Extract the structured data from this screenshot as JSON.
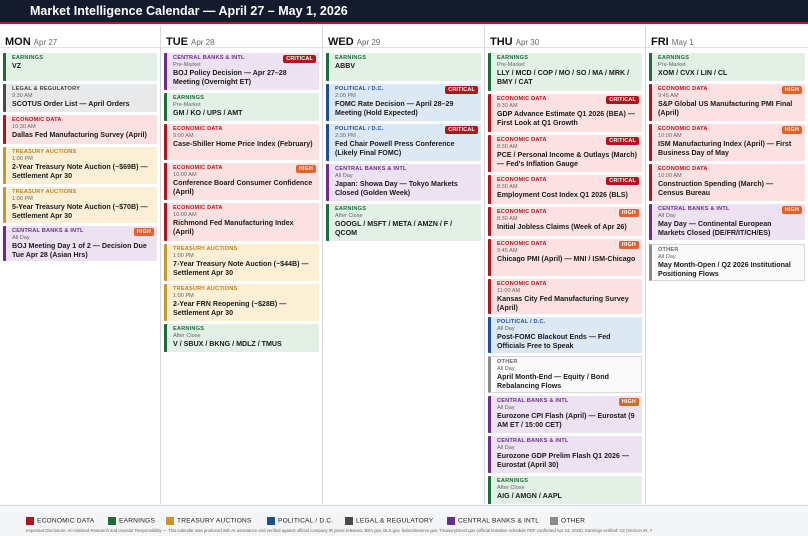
{
  "header": {
    "title": "Market Intelligence Calendar — April 27 – May 1, 2026"
  },
  "colors": {
    "economic_data": "#b3141c",
    "earnings": "#1e6b3a",
    "treasury_auctions": "#c9962a",
    "political_dc": "#1d4f96",
    "legal_regulatory": "#4a4a4a",
    "central_banks_intl": "#6b2c8c",
    "other": "#8a8a8a",
    "badge_critical": "#b3141c",
    "badge_high": "#e2622b"
  },
  "days": [
    {
      "name": "MON",
      "date": "Apr 27",
      "events": [
        {
          "category": "EARNINGS",
          "time": "",
          "title": "VZ",
          "badge": ""
        },
        {
          "category": "LEGAL & REGULATORY",
          "time": "9:30 AM",
          "title": "SCOTUS Order List — April Orders",
          "badge": ""
        },
        {
          "category": "ECONOMIC DATA",
          "time": "10:30 AM",
          "title": "Dallas Fed Manufacturing Survey (April)",
          "badge": ""
        },
        {
          "category": "TREASURY AUCTIONS",
          "time": "1:00 PM",
          "title": "2-Year Treasury Note Auction (~$69B) — Settlement Apr 30",
          "badge": ""
        },
        {
          "category": "TREASURY AUCTIONS",
          "time": "1:00 PM",
          "title": "5-Year Treasury Note Auction (~$70B) — Settlement Apr 30",
          "badge": ""
        },
        {
          "category": "CENTRAL BANKS & INTL",
          "time": "All Day",
          "title": "BOJ Meeting Day 1 of 2 — Decision Due Tue Apr 28 (Asian Hrs)",
          "badge": "HIGH"
        }
      ]
    },
    {
      "name": "TUE",
      "date": "Apr 28",
      "events": [
        {
          "category": "CENTRAL BANKS & INTL",
          "time": "Pre-Market",
          "title": "BOJ Policy Decision — Apr 27–28 Meeting (Overnight ET)",
          "badge": "CRITICAL"
        },
        {
          "category": "EARNINGS",
          "time": "Pre-Market",
          "title": "GM / KO / UPS / AMT",
          "badge": ""
        },
        {
          "category": "ECONOMIC DATA",
          "time": "9:00 AM",
          "title": "Case-Shiller Home Price Index (February)",
          "badge": ""
        },
        {
          "category": "ECONOMIC DATA",
          "time": "10:00 AM",
          "title": "Conference Board Consumer Confidence (April)",
          "badge": "HIGH"
        },
        {
          "category": "ECONOMIC DATA",
          "time": "10:00 AM",
          "title": "Richmond Fed Manufacturing Index (April)",
          "badge": ""
        },
        {
          "category": "TREASURY AUCTIONS",
          "time": "1:00 PM",
          "title": "7-Year Treasury Note Auction (~$44B) — Settlement Apr 30",
          "badge": ""
        },
        {
          "category": "TREASURY AUCTIONS",
          "time": "1:00 PM",
          "title": "2-Year FRN Reopening (~$28B) — Settlement Apr 30",
          "badge": ""
        },
        {
          "category": "EARNINGS",
          "time": "After Close",
          "title": "V / SBUX / BKNG / MDLZ / TMUS",
          "badge": ""
        }
      ]
    },
    {
      "name": "WED",
      "date": "Apr 29",
      "events": [
        {
          "category": "EARNINGS",
          "time": "",
          "title": "ABBV",
          "badge": ""
        },
        {
          "category": "POLITICAL / D.C.",
          "time": "2:00 PM",
          "title": "FOMC Rate Decision — April 28–29 Meeting (Hold Expected)",
          "badge": "CRITICAL"
        },
        {
          "category": "POLITICAL / D.C.",
          "time": "2:30 PM",
          "title": "Fed Chair Powell Press Conference (Likely Final FOMC)",
          "badge": "CRITICAL"
        },
        {
          "category": "CENTRAL BANKS & INTL",
          "time": "All Day",
          "title": "Japan: Showa Day — Tokyo Markets Closed (Golden Week)",
          "badge": ""
        },
        {
          "category": "EARNINGS",
          "time": "After Close",
          "title": "GOOGL / MSFT / META / AMZN / F / QCOM",
          "badge": ""
        }
      ]
    },
    {
      "name": "THU",
      "date": "Apr 30",
      "events": [
        {
          "category": "EARNINGS",
          "time": "Pre-Market",
          "title": "LLY / MCD / COP / MO / SO / MA / MRK / BMY / CAT",
          "badge": ""
        },
        {
          "category": "ECONOMIC DATA",
          "time": "8:30 AM",
          "title": "GDP Advance Estimate Q1 2026 (BEA) — First Look at Q1 Growth",
          "badge": "CRITICAL"
        },
        {
          "category": "ECONOMIC DATA",
          "time": "8:30 AM",
          "title": "PCE / Personal Income & Outlays (March) — Fed's Inflation Gauge",
          "badge": "CRITICAL"
        },
        {
          "category": "ECONOMIC DATA",
          "time": "8:30 AM",
          "title": "Employment Cost Index Q1 2026 (BLS)",
          "badge": "CRITICAL"
        },
        {
          "category": "ECONOMIC DATA",
          "time": "8:30 AM",
          "title": "Initial Jobless Claims (Week of Apr 26)",
          "badge": "HIGH"
        },
        {
          "category": "ECONOMIC DATA",
          "time": "9:45 AM",
          "title": "Chicago PMI (April) — MNI / ISM-Chicago",
          "badge": "HIGH"
        },
        {
          "category": "ECONOMIC DATA",
          "time": "11:00 AM",
          "title": "Kansas City Fed Manufacturing Survey (April)",
          "badge": ""
        },
        {
          "category": "POLITICAL / D.C.",
          "time": "All Day",
          "title": "Post-FOMC Blackout Ends — Fed Officials Free to Speak",
          "badge": ""
        },
        {
          "category": "OTHER",
          "time": "All Day",
          "title": "April Month-End — Equity / Bond Rebalancing Flows",
          "badge": ""
        },
        {
          "category": "CENTRAL BANKS & INTL",
          "time": "All Day",
          "title": "Eurozone CPI Flash (April) — Eurostat (9 AM ET / 15:00 CET)",
          "badge": "HIGH"
        },
        {
          "category": "CENTRAL BANKS & INTL",
          "time": "All Day",
          "title": "Eurozone GDP Prelim Flash Q1 2026 — Eurostat (April 30)",
          "badge": ""
        },
        {
          "category": "EARNINGS",
          "time": "After Close",
          "title": "AIG / AMGN / AAPL",
          "badge": ""
        }
      ]
    },
    {
      "name": "FRI",
      "date": "May 1",
      "events": [
        {
          "category": "EARNINGS",
          "time": "Pre-Market",
          "title": "XOM / CVX / LIN / CL",
          "badge": ""
        },
        {
          "category": "ECONOMIC DATA",
          "time": "9:45 AM",
          "title": "S&P Global US Manufacturing PMI Final (April)",
          "badge": "HIGH"
        },
        {
          "category": "ECONOMIC DATA",
          "time": "10:00 AM",
          "title": "ISM Manufacturing Index (April) — First Business Day of May",
          "badge": "HIGH"
        },
        {
          "category": "ECONOMIC DATA",
          "time": "10:00 AM",
          "title": "Construction Spending (March) — Census Bureau",
          "badge": ""
        },
        {
          "category": "CENTRAL BANKS & INTL",
          "time": "All Day",
          "title": "May Day — Continental European Markets Closed (DE/FR/IT/CH/ES)",
          "badge": "HIGH"
        },
        {
          "category": "OTHER",
          "time": "All Day",
          "title": "May Month-Open / Q2 2026 Institutional Positioning Flows",
          "badge": ""
        }
      ]
    }
  ],
  "legend": [
    {
      "label": "ECONOMIC DATA",
      "color": "#b3141c"
    },
    {
      "label": "EARNINGS",
      "color": "#1e6b3a"
    },
    {
      "label": "TREASURY AUCTIONS",
      "color": "#c9962a"
    },
    {
      "label": "POLITICAL / D.C.",
      "color": "#1d4f96"
    },
    {
      "label": "LEGAL & REGULATORY",
      "color": "#4a4a4a"
    },
    {
      "label": "CENTRAL BANKS & INTL",
      "color": "#6b2c8c"
    },
    {
      "label": "OTHER",
      "color": "#8a8a8a"
    }
  ],
  "footer": {
    "disclaimer": "Important Disclosure: AI-Assisted Research and Investor Responsibility — This calendar was produced with AI assistance and verified against official company IR press releases, BEA.gov, BLS.gov, federalreserve.gov, TreasuryDirect.gov (official tentative schedule PDF confirmed Apr 24, 2026). Earnings verified: VZ (Verizon IR, 7"
  }
}
